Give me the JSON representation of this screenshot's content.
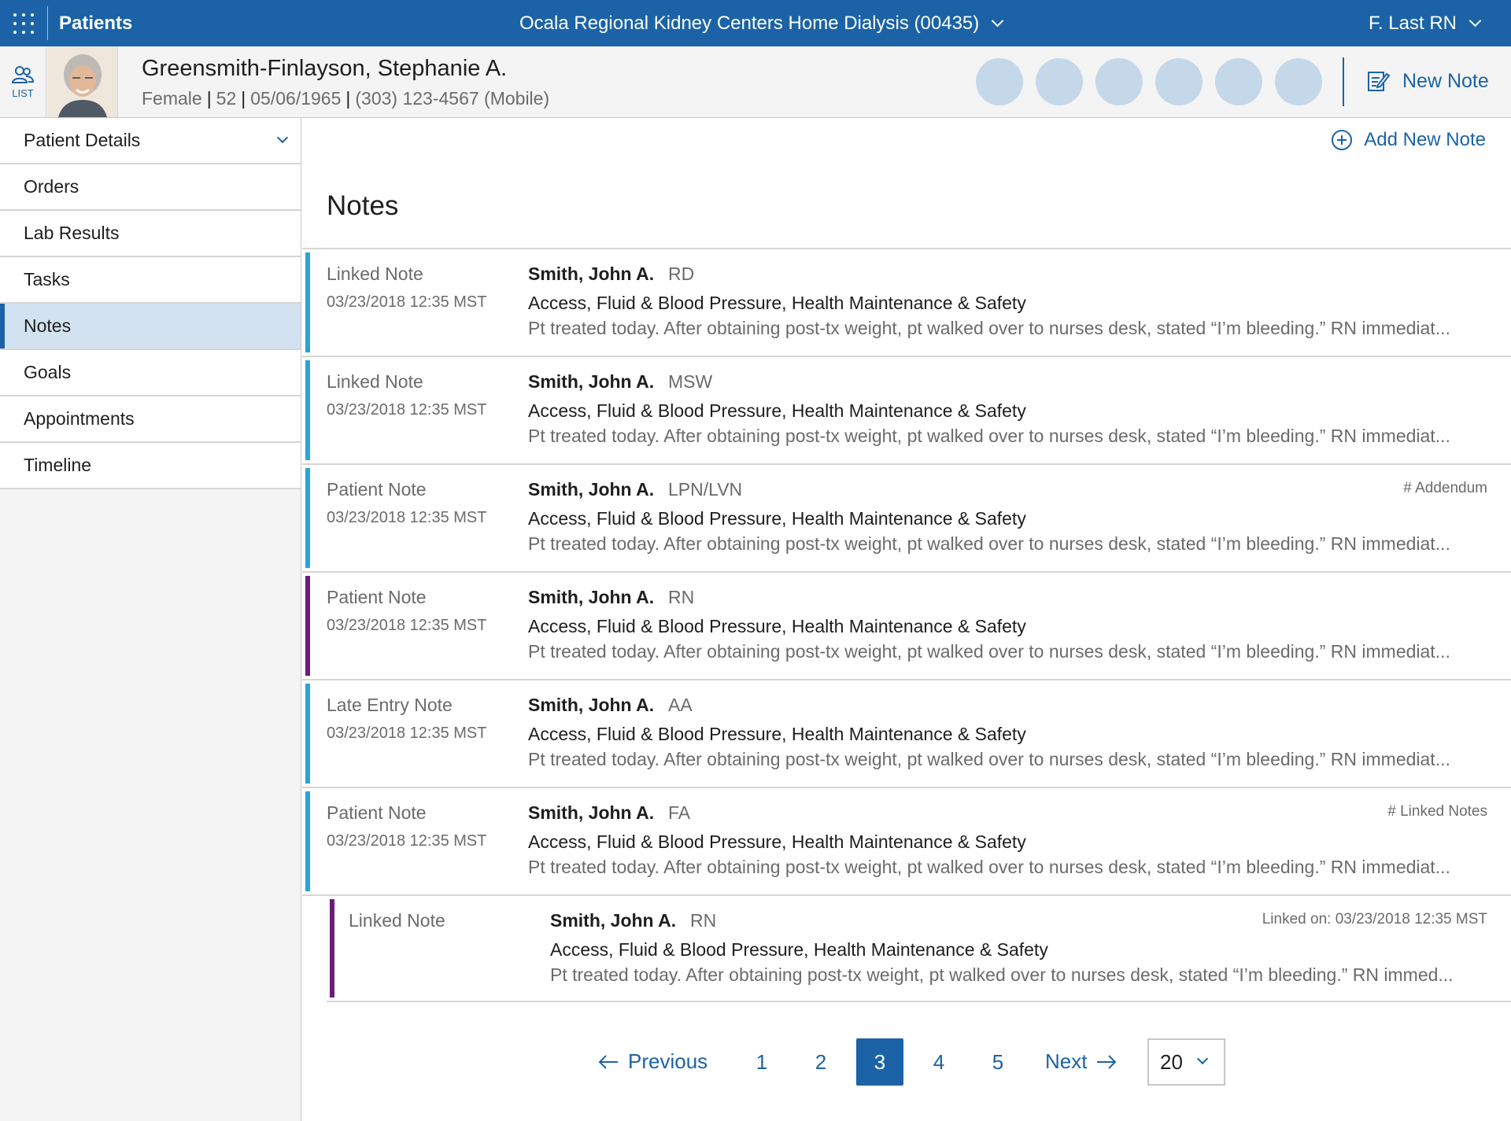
{
  "topbar": {
    "app_title": "Patients",
    "facility": "Ocala Regional Kidney Centers Home Dialysis (00435)",
    "user": "F. Last RN"
  },
  "patient": {
    "list_label": "LIST",
    "name": "Greensmith-Finlayson, Stephanie A.",
    "gender": "Female",
    "age": "52",
    "dob": "05/06/1965",
    "phone": "(303) 123-4567 (Mobile)",
    "new_note_label": "New Note"
  },
  "sidebar": {
    "items": [
      {
        "label": "Patient Details"
      },
      {
        "label": "Orders"
      },
      {
        "label": "Lab Results"
      },
      {
        "label": "Tasks"
      },
      {
        "label": "Notes"
      },
      {
        "label": "Goals"
      },
      {
        "label": "Appointments"
      },
      {
        "label": "Timeline"
      }
    ]
  },
  "main": {
    "add_new_note": "Add New Note",
    "title": "Notes",
    "notes": [
      {
        "type": "Linked Note",
        "date": "03/23/2018 12:35 MST",
        "author": "Smith, John A.",
        "role": "RD",
        "topic": "Access, Fluid & Blood Pressure, Health Maintenance & Safety",
        "text": "Pt treated today. After obtaining post-tx weight, pt walked over to nurses desk, stated “I’m bleeding.” RN immediat...",
        "tag": "",
        "accent": "#2aa4d8"
      },
      {
        "type": "Linked Note",
        "date": "03/23/2018 12:35 MST",
        "author": "Smith, John A.",
        "role": "MSW",
        "topic": "Access, Fluid & Blood Pressure, Health Maintenance & Safety",
        "text": "Pt treated today. After obtaining post-tx weight, pt walked over to nurses desk, stated “I’m bleeding.” RN immediat...",
        "tag": "",
        "accent": "#2aa4d8"
      },
      {
        "type": "Patient Note",
        "date": "03/23/2018 12:35 MST",
        "author": "Smith, John A.",
        "role": "LPN/LVN",
        "topic": "Access, Fluid & Blood Pressure, Health Maintenance & Safety",
        "text": "Pt treated today. After obtaining post-tx weight, pt walked over to nurses desk, stated “I’m bleeding.” RN immediat...",
        "tag": "# Addendum",
        "accent": "#2aa4d8"
      },
      {
        "type": "Patient Note",
        "date": "03/23/2018 12:35 MST",
        "author": "Smith, John A.",
        "role": "RN",
        "topic": "Access, Fluid & Blood Pressure, Health Maintenance & Safety",
        "text": "Pt treated today. After obtaining post-tx weight, pt walked over to nurses desk, stated “I’m bleeding.” RN immediat...",
        "tag": "",
        "accent": "#6b1d7b"
      },
      {
        "type": "Late Entry Note",
        "date": "03/23/2018 12:35 MST",
        "author": "Smith, John A.",
        "role": "AA",
        "topic": "Access, Fluid & Blood Pressure, Health Maintenance & Safety",
        "text": "Pt treated today. After obtaining post-tx weight, pt walked over to nurses desk, stated “I’m bleeding.” RN immediat...",
        "tag": "",
        "accent": "#2aa4d8"
      },
      {
        "type": "Patient Note",
        "date": "03/23/2018 12:35 MST",
        "author": "Smith, John A.",
        "role": "FA",
        "topic": "Access, Fluid & Blood Pressure, Health Maintenance & Safety",
        "text": "Pt treated today. After obtaining post-tx weight, pt walked over to nurses desk, stated “I’m bleeding.” RN immediat...",
        "tag": "# Linked Notes",
        "accent": "#2aa4d8"
      }
    ],
    "linked": {
      "type": "Linked Note",
      "author": "Smith, John A.",
      "role": "RN",
      "topic": "Access, Fluid & Blood Pressure, Health Maintenance & Safety",
      "text": "Pt treated today. After obtaining post-tx weight, pt walked over to nurses desk, stated “I’m bleeding.” RN immed...",
      "tag": "Linked on: 03/23/2018 12:35 MST",
      "accent": "#6b1d7b"
    }
  },
  "pagination": {
    "previous": "Previous",
    "pages": [
      "1",
      "2",
      "3",
      "4",
      "5"
    ],
    "current": "3",
    "next": "Next",
    "page_size": "20"
  },
  "colors": {
    "brand": "#1b63a6",
    "accent_blue": "#2aa4d8",
    "accent_purple": "#6b1d7b"
  }
}
